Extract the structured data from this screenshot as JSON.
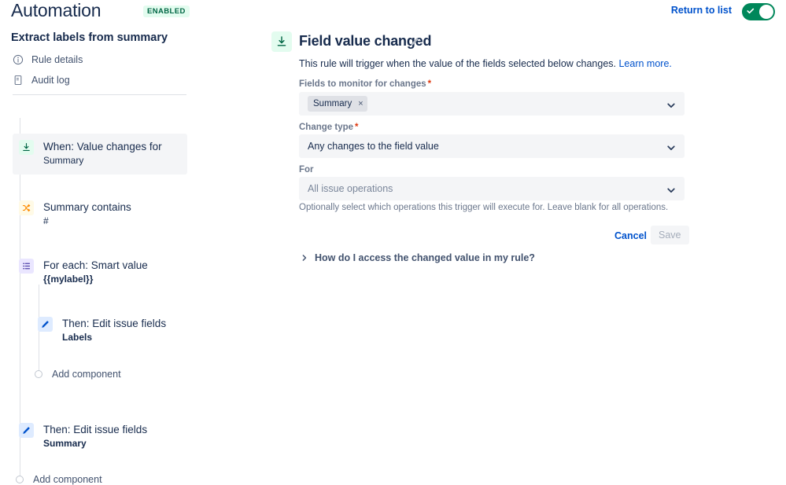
{
  "header": {
    "title": "Automation",
    "status_badge": "ENABLED",
    "return_link": "Return to list",
    "toggle_state": "on",
    "toggle_color": "#00875a"
  },
  "left_panel": {
    "rule_name": "Extract labels from summary",
    "nav_items": [
      {
        "label": "Rule details",
        "icon": "info-circle-icon"
      },
      {
        "label": "Audit log",
        "icon": "document-icon"
      }
    ],
    "tree": {
      "nodes": [
        {
          "title": "When: Value changes for",
          "subtitle": "Summary",
          "icon": "field-value-changed-icon",
          "icon_color": "#e3fcef",
          "selected": true,
          "bold_sub": false
        },
        {
          "title": "Summary contains",
          "subtitle": "#",
          "icon": "condition-shuffle-icon",
          "icon_color": "#fffae6",
          "selected": false,
          "bold_sub": false
        },
        {
          "title": "For each: Smart value",
          "subtitle": "{{mylabel}}",
          "icon": "branch-list-icon",
          "icon_color": "#eae6ff",
          "selected": false,
          "bold_sub": true
        },
        {
          "title": "Then: Edit issue fields",
          "subtitle": "Labels",
          "icon": "edit-pencil-icon",
          "icon_color": "#deebff",
          "selected": false,
          "bold_sub": true
        },
        {
          "title": "Then: Edit issue fields",
          "subtitle": "Summary",
          "icon": "edit-pencil-icon",
          "icon_color": "#deebff",
          "selected": false,
          "bold_sub": true
        }
      ],
      "add_component_inner": "Add component",
      "add_component_outer": "Add component"
    }
  },
  "right_panel": {
    "trigger_icon": "field-value-changed-icon",
    "trigger_title": "Field value changed",
    "edit_icon": "pencil-icon",
    "description_text": "This rule will trigger when the value of the fields selected below changes.",
    "learn_more": "Learn more.",
    "fields_to_monitor": {
      "label": "Fields to monitor for changes",
      "required": "*",
      "tags": [
        {
          "label": "Summary",
          "remove": "×"
        }
      ]
    },
    "change_type": {
      "label": "Change type",
      "required": "*",
      "value": "Any changes to the field value"
    },
    "for_field": {
      "label": "For",
      "placeholder": "All issue operations",
      "help_text": "Optionally select which operations this trigger will execute for. Leave blank for all operations."
    },
    "cancel_label": "Cancel",
    "save_label": "Save",
    "how_do_i_label": "How do I access the changed value in my rule?"
  }
}
